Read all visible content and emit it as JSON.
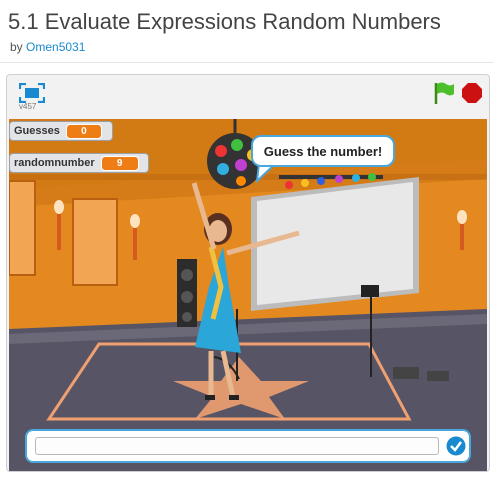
{
  "project": {
    "title": "5.1 Evaluate Expressions Random Numbers",
    "by_label": "by",
    "author": "Omen5031"
  },
  "player": {
    "version": "v457",
    "fullscreen_icon": "fullscreen-icon",
    "green_flag_icon": "green-flag-icon",
    "stop_icon": "stop-sign-icon"
  },
  "monitors": [
    {
      "label": "Guesses",
      "value": "0"
    },
    {
      "label": "randomnumber",
      "value": "9"
    }
  ],
  "speech_bubble": {
    "text": "Guess the number!"
  },
  "ask_prompt": {
    "value": "",
    "submit_icon": "checkmark-icon"
  },
  "colors": {
    "monitor_value": "#ee7d16",
    "accent_blue": "#4aa7dd",
    "wall_orange": "#e3891f",
    "flag_green": "#4cbf2a",
    "stop_red": "#cc1111"
  }
}
